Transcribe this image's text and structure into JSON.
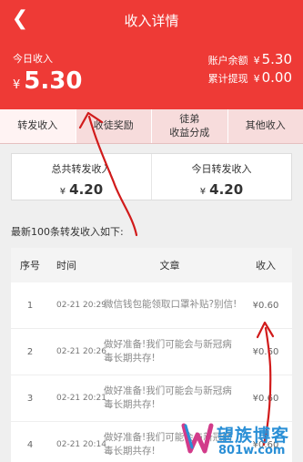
{
  "header": {
    "back_icon": "chevron-left-icon",
    "back_glyph": "❮",
    "title": "收入详情"
  },
  "hero": {
    "today_label": "今日收入",
    "currency": "¥",
    "today_amount": "5.30",
    "balance_label": "账户余额",
    "balance_value": "5.30",
    "withdrawn_label": "累计提现",
    "withdrawn_value": "0.00"
  },
  "tabs": [
    {
      "label": "转发收入",
      "active": true
    },
    {
      "label": "收徒奖励"
    },
    {
      "label_line1": "徒弟",
      "label_line2": "收益分成"
    },
    {
      "label": "其他收入"
    }
  ],
  "summary": {
    "total_label": "总共转发收入",
    "total_value": "4.20",
    "today_label": "今日转发收入",
    "today_value": "4.20"
  },
  "list_title": "最新100条转发收入如下:",
  "table": {
    "headers": {
      "no": "序号",
      "time": "时间",
      "article": "文章",
      "income": "收入"
    },
    "rows": [
      {
        "no": "1",
        "time": "02-21 20:29",
        "article": "微信钱包能领取口罩补贴?别信!",
        "income": "¥0.60"
      },
      {
        "no": "2",
        "time": "02-21 20:26",
        "article": "做好准备!我们可能会与新冠病毒长期共存!",
        "income": "¥0.60"
      },
      {
        "no": "3",
        "time": "02-21 20:21",
        "article": "做好准备!我们可能会与新冠病毒长期共存!",
        "income": "¥0.60"
      },
      {
        "no": "4",
        "time": "02-21 20:14",
        "article": "做好准备!我们可能会与新冠病毒长期共存!",
        "income": "¥0.60"
      }
    ]
  },
  "watermark": {
    "brand": "望族博客",
    "url": "801w.com"
  },
  "colors": {
    "brand_red": "#ee3a36",
    "tab_bg": "#f7dcdc",
    "annotation_red": "#d11b1b",
    "watermark_blue": "#2a8fd6"
  }
}
